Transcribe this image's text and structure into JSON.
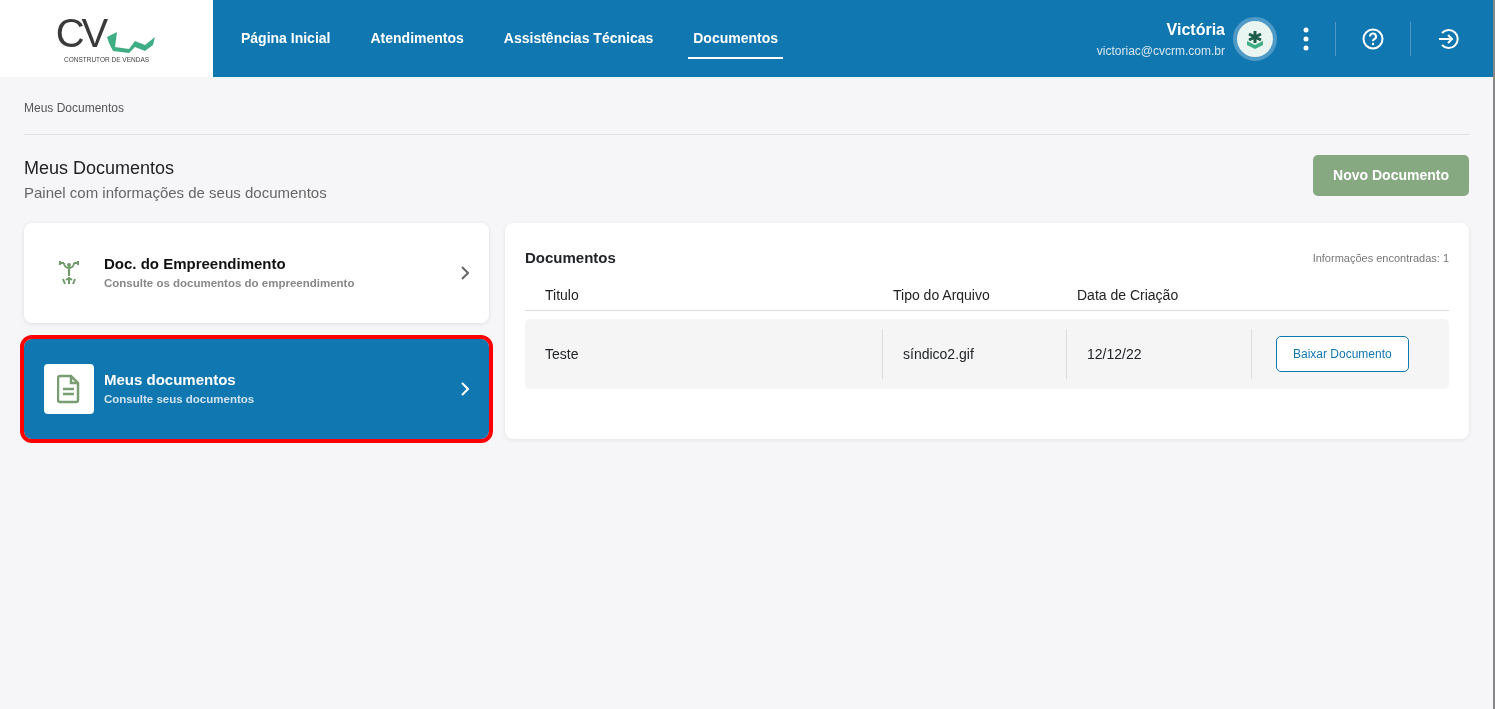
{
  "logo": {
    "mark": "CV",
    "tagline": "CONSTRUTOR DE VENDAS"
  },
  "nav": [
    {
      "label": "Página Inicial",
      "selected": false
    },
    {
      "label": "Atendimentos",
      "selected": false
    },
    {
      "label": "Assistências Técnicas",
      "selected": false
    },
    {
      "label": "Documentos",
      "selected": true
    }
  ],
  "user": {
    "name": "Victória",
    "email": "victoriac@cvcrm.com.br"
  },
  "breadcrumb": "Meus Documentos",
  "page": {
    "title": "Meus Documentos",
    "subtitle": "Painel com informações de seus documentos",
    "action": "Novo Documento"
  },
  "menu": [
    {
      "kind": "building",
      "title": "Doc. do Empreendimento",
      "subtitle": "Consulte os documentos do empreendimento",
      "selected": false,
      "highlighted": false
    },
    {
      "kind": "document",
      "title": "Meus documentos",
      "subtitle": "Consulte seus documentos",
      "selected": true,
      "highlighted": true
    }
  ],
  "table": {
    "title": "Documentos",
    "count": "Informações encontradas: 1",
    "columns": [
      "Titulo",
      "Tipo do Arquivo",
      "Data de Criação"
    ],
    "rows": [
      {
        "cells": [
          "Teste",
          "síndico2.gif",
          "12/12/22"
        ],
        "action": "Baixar Documento"
      }
    ]
  }
}
